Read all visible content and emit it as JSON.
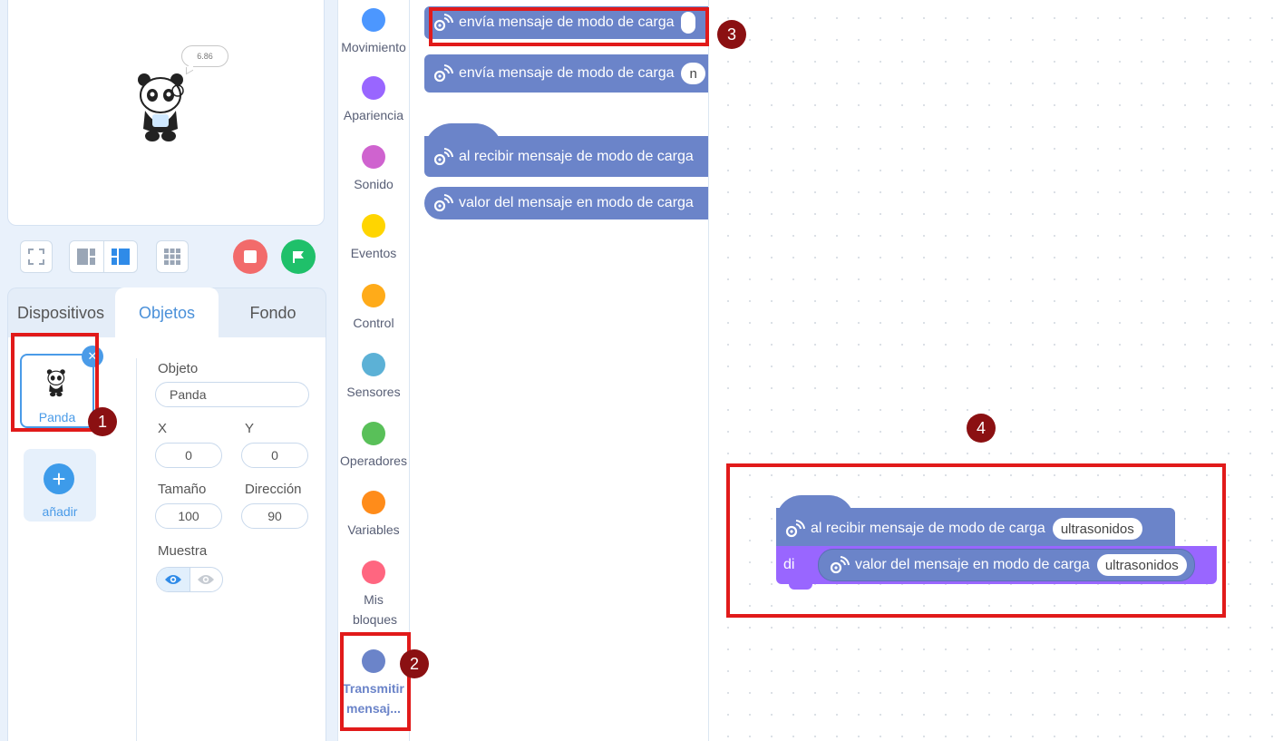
{
  "stage": {
    "speech_bubble": "6.86",
    "toolbar_icons": [
      "fullscreen-icon",
      "small-stage-icon",
      "large-stage-icon",
      "grid-icon"
    ],
    "stop_color": "#f26b6b",
    "go_color": "#1fc06a"
  },
  "tabs": {
    "devices": "Dispositivos",
    "objects": "Objetos",
    "background": "Fondo"
  },
  "sprite": {
    "card_label": "Panda",
    "add_label": "añadir"
  },
  "properties": {
    "object_label": "Objeto",
    "object_value": "Panda",
    "x_label": "X",
    "x_value": "0",
    "y_label": "Y",
    "y_value": "0",
    "size_label": "Tamaño",
    "size_value": "100",
    "direction_label": "Dirección",
    "direction_value": "90",
    "show_label": "Muestra"
  },
  "categories": [
    {
      "label": "Movimiento",
      "color": "#4c97ff"
    },
    {
      "label": "Apariencia",
      "color": "#9966ff"
    },
    {
      "label": "Sonido",
      "color": "#cf63cf"
    },
    {
      "label": "Eventos",
      "color": "#ffd500"
    },
    {
      "label": "Control",
      "color": "#ffab19"
    },
    {
      "label": "Sensores",
      "color": "#5cb1d6"
    },
    {
      "label": "Operadores",
      "color": "#59c059"
    },
    {
      "label": "Variables",
      "color": "#ff8c1a"
    },
    {
      "label": "Mis bloques",
      "color": "#ff6680"
    },
    {
      "label": "Transmitir mensaj...",
      "color": "#6b84c9"
    }
  ],
  "palette": {
    "block1": "envía mensaje de modo de carga",
    "block2": "envía mensaje de modo de carga",
    "block2_pill": "n",
    "block3": "al recibir mensaje de modo de carga",
    "block4": "valor del mensaje en modo de carga",
    "block_color": "#6b84c9"
  },
  "workspace": {
    "hat_text": "al recibir mensaje de modo de carga",
    "hat_value": "ultrasonidos",
    "say_text": "di",
    "reporter_text": "valor del mensaje en modo de carga",
    "reporter_value": "ultrasonidos",
    "say_color": "#9966ff"
  },
  "annotations": {
    "badge1": "1",
    "badge2": "2",
    "badge3": "3",
    "badge4": "4",
    "box_color": "#e11a1a"
  }
}
